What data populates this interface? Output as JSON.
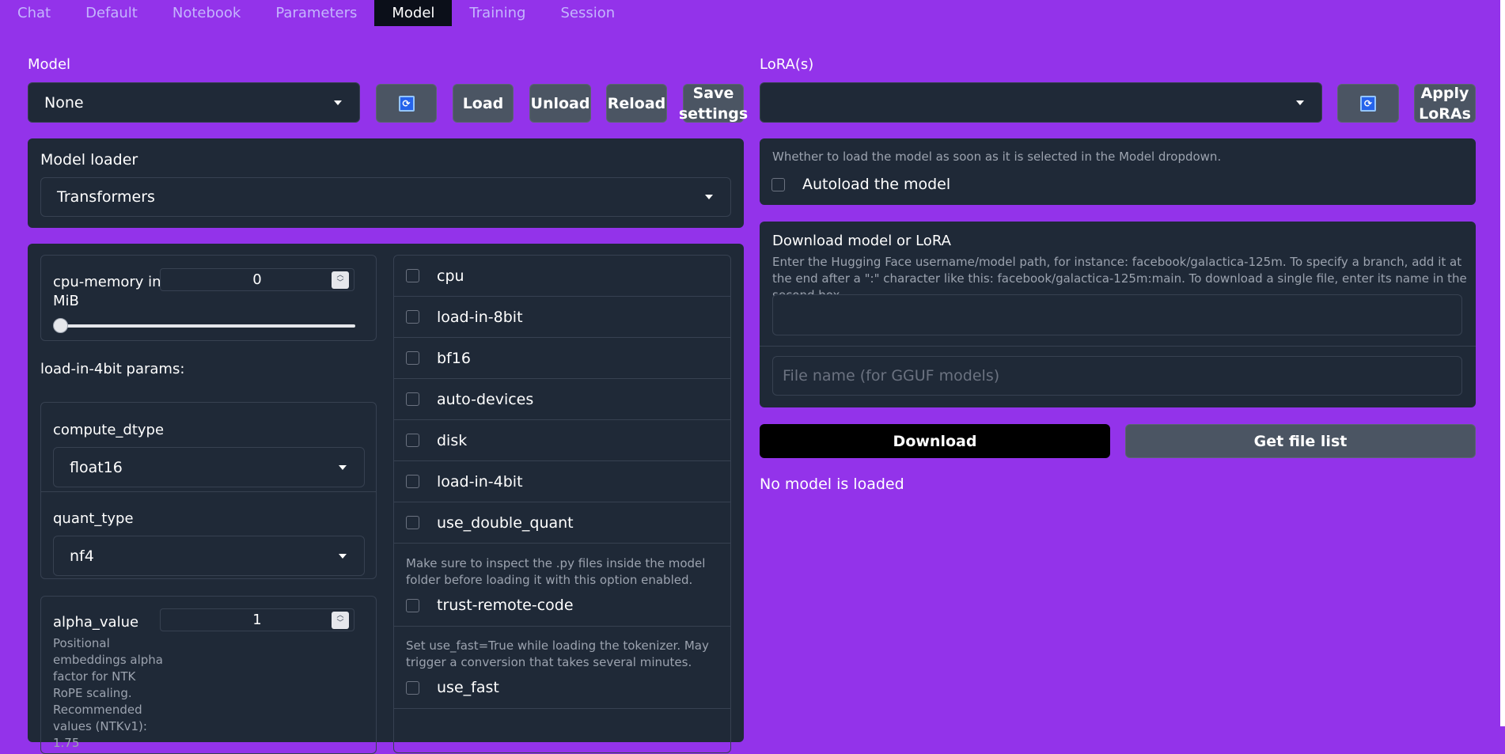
{
  "tabs": [
    "Chat",
    "Default",
    "Notebook",
    "Parameters",
    "Model",
    "Training",
    "Session"
  ],
  "model": {
    "label": "Model",
    "selected": "None",
    "refresh_icon": "refresh-icon",
    "load": "Load",
    "unload": "Unload",
    "reload": "Reload",
    "save_settings": "Save settings"
  },
  "lora": {
    "label": "LoRA(s)",
    "selected": "",
    "apply": "Apply LoRAs"
  },
  "loader": {
    "label": "Model loader",
    "selected": "Transformers"
  },
  "cpu_memory": {
    "label": "cpu-memory in MiB",
    "value": "0"
  },
  "load4bit_params": {
    "heading": "load-in-4bit params:",
    "compute_dtype_label": "compute_dtype",
    "compute_dtype": "float16",
    "quant_type_label": "quant_type",
    "quant_type": "nf4"
  },
  "alpha": {
    "label": "alpha_value",
    "value": "1",
    "info": "Positional embeddings alpha factor for NTK RoPE scaling. Recommended values (NTKv1): 1.75"
  },
  "checkboxes": [
    "cpu",
    "load-in-8bit",
    "bf16",
    "auto-devices",
    "disk",
    "load-in-4bit",
    "use_double_quant"
  ],
  "trust_remote": {
    "info": "Make sure to inspect the .py files inside the model folder before loading it with this option enabled.",
    "label": "trust-remote-code"
  },
  "use_fast": {
    "info": "Set use_fast=True while loading the tokenizer. May trigger a conversion that takes several minutes.",
    "label": "use_fast"
  },
  "autoload": {
    "info": "Whether to load the model as soon as it is selected in the Model dropdown.",
    "label": "Autoload the model"
  },
  "download": {
    "title": "Download model or LoRA",
    "info": "Enter the Hugging Face username/model path, for instance: facebook/galactica-125m. To specify a branch, add it at the end after a \":\" character like this: facebook/galactica-125m:main. To download a single file, enter its name in the second box.",
    "file_placeholder": "File name (for GGUF models)",
    "download_btn": "Download",
    "file_list_btn": "Get file list",
    "status": "No model is loaded"
  }
}
